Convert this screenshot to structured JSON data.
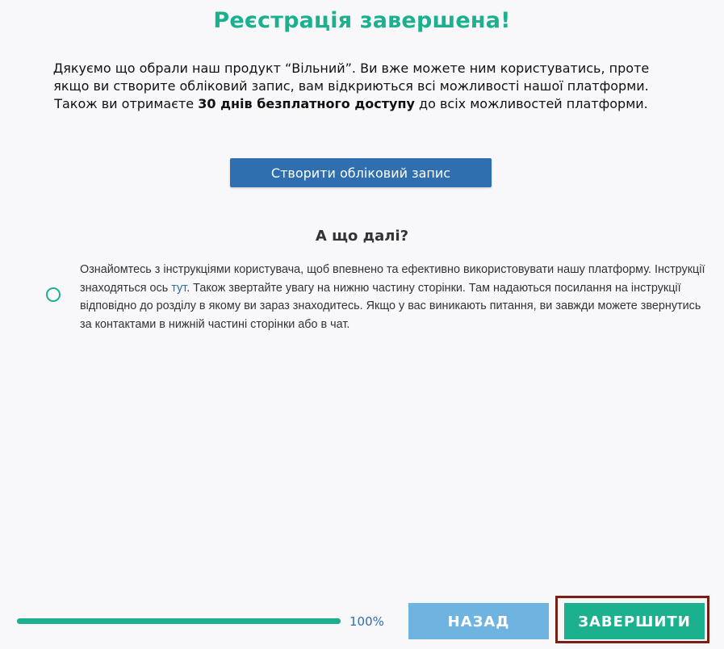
{
  "header": {
    "title": "Реєстрація завершена!"
  },
  "intro": {
    "text_before": "Дякуємо що обрали наш продукт “Вільний”. Ви вже можете ним користуватись, проте якщо ви створите обліковий запис, вам відкриються всі можливості нашої платформи. Також ви отримаєте ",
    "text_bold": "30 днів безплатного доступу",
    "text_after": " до всіх можливостей платформи."
  },
  "create_account": {
    "label": "Створити обліковий запис"
  },
  "next_steps": {
    "heading": "А що далі?",
    "items": [
      {
        "text_before": "Ознайомтесь з інструкціями користувача, щоб впевнено та ефективно використовувати нашу платформу. Інструкції знаходяться ось ",
        "link_text": "тут",
        "text_after": ". Також звертайте увагу на нижню частину сторінки. Там надаються посилання на інструкції відповідно до розділу в якому ви зараз знаходитесь. Якщо у вас виникають питання, ви завжди можете звернутись за контактами в нижній частині сторінки або в чат."
      }
    ]
  },
  "footer": {
    "progress_label": "100%",
    "progress_fraction": 1.0,
    "back_label": "НАЗАД",
    "finish_label": "ЗАВЕРШИТИ"
  },
  "colors": {
    "accent_green": "#1bb08e",
    "primary_blue": "#2f6eaf",
    "light_blue": "#6fb3e0",
    "highlight_outline": "#7a1f12",
    "background": "#f8f7fa"
  }
}
